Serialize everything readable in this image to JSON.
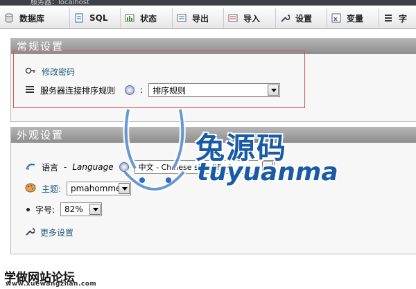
{
  "header": {
    "crumb": "服务器：localhost"
  },
  "tabs": [
    {
      "label": "数据库",
      "icon": "database-icon"
    },
    {
      "label": "SQL",
      "icon": "sql-icon"
    },
    {
      "label": "状态",
      "icon": "status-icon"
    },
    {
      "label": "导出",
      "icon": "export-icon"
    },
    {
      "label": "导入",
      "icon": "import-icon"
    },
    {
      "label": "设置",
      "icon": "wrench-icon"
    },
    {
      "label": "变量",
      "icon": "variables-icon"
    },
    {
      "label": "字",
      "icon": "charset-icon"
    }
  ],
  "general": {
    "title": "常规设置",
    "change_password": "修改密码",
    "collation_label": "服务器连接排序规则",
    "colon": ":",
    "collation_value": "排序规则"
  },
  "appearance": {
    "title": "外观设置",
    "language_label": "语言",
    "language_dash": "-",
    "language_en": "Language",
    "language_value": "中文 - Chinese simplified",
    "theme_label": "主题:",
    "theme_value": "pmahomme",
    "font_label": "字号:",
    "font_value": "82%",
    "more_settings": "更多设置"
  },
  "watermark": {
    "text": "兔源码",
    "latin": "tuyuanma",
    "footer": "学做网站论坛",
    "footer_url": "www.xuewangzhan.com"
  },
  "colors": {
    "accent": "#1a5ba8",
    "link": "#235a81",
    "highlight": "#e05050"
  }
}
